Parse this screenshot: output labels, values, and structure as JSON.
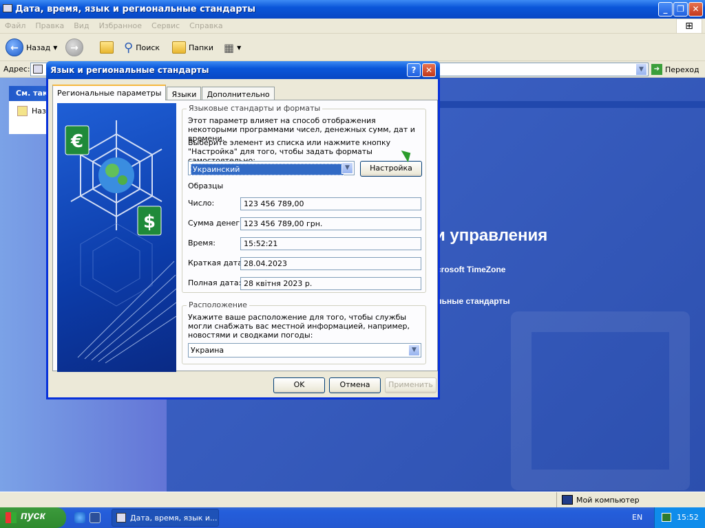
{
  "window": {
    "title": "Дата, время, язык и региональные стандарты"
  },
  "menu": [
    "Файл",
    "Правка",
    "Вид",
    "Избранное",
    "Сервис",
    "Справка"
  ],
  "toolbar": {
    "back": "Назад",
    "search": "Поиск",
    "folders": "Папки"
  },
  "address": {
    "label": "Адрес:",
    "go": "Переход"
  },
  "left_pane": {
    "see_also_header": "См. так",
    "see_also_item": "Наз"
  },
  "right_pane": {
    "heading": "и управления",
    "link_timezone": "crosoft TimeZone",
    "link_regional": "льные стандарты"
  },
  "statusbar": {
    "computer": "Мой компьютер"
  },
  "taskbar": {
    "start": "пуск",
    "task_item": "Дата, время, язык и...",
    "lang": "EN",
    "clock": "15:52"
  },
  "dialog": {
    "title": "Язык и региональные стандарты",
    "tabs": [
      "Региональные параметры",
      "Языки",
      "Дополнительно"
    ],
    "group1": {
      "label": "Языковые стандарты и форматы",
      "desc1": "Этот параметр влияет на способ отображения некоторыми программами чисел, денежных сумм, дат и времени.",
      "desc2": "Выберите элемент из списка или нажмите кнопку \"Настройка\" для того, чтобы задать форматы самостоятельно:",
      "locale_value": "Украинский",
      "customize": "Настройка",
      "samples_label": "Образцы",
      "samples": [
        {
          "label": "Число:",
          "value": "123 456 789,00"
        },
        {
          "label": "Сумма денег:",
          "value": "123 456 789,00 грн."
        },
        {
          "label": "Время:",
          "value": "15:52:21"
        },
        {
          "label": "Краткая дата:",
          "value": "28.04.2023"
        },
        {
          "label": "Полная дата:",
          "value": "28 квітня 2023 р."
        }
      ]
    },
    "group2": {
      "label": "Расположение",
      "desc": "Укажите ваше расположение для того, чтобы службы могли снабжать вас местной информацией, например, новостями и сводками погоды:",
      "location_value": "Украина"
    },
    "buttons": {
      "ok": "OK",
      "cancel": "Отмена",
      "apply": "Применить"
    }
  }
}
